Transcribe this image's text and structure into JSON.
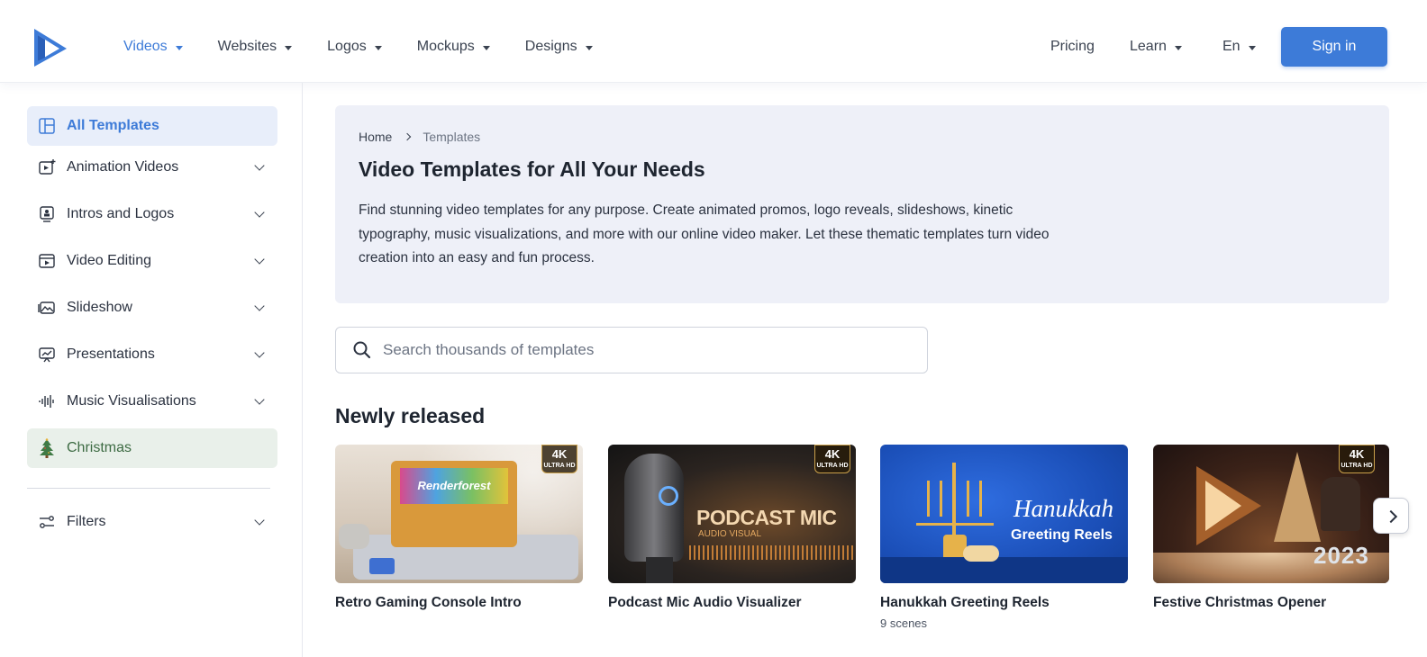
{
  "header": {
    "nav": [
      {
        "label": "Videos",
        "active": true
      },
      {
        "label": "Websites"
      },
      {
        "label": "Logos"
      },
      {
        "label": "Mockups"
      },
      {
        "label": "Designs"
      }
    ],
    "pricing": "Pricing",
    "learn": "Learn",
    "language": "En",
    "signin": "Sign in",
    "accent_color": "#3d7bd8"
  },
  "sidebar": {
    "items": [
      {
        "label": "All Templates",
        "icon": "grid-icon",
        "active": true
      },
      {
        "label": "Animation Videos",
        "icon": "video-plus-icon"
      },
      {
        "label": "Intros and Logos",
        "icon": "badge-icon"
      },
      {
        "label": "Video Editing",
        "icon": "film-icon"
      },
      {
        "label": "Slideshow",
        "icon": "image-icon"
      },
      {
        "label": "Presentations",
        "icon": "presentation-icon"
      },
      {
        "label": "Music Visualisations",
        "icon": "waveform-icon"
      },
      {
        "label": "Christmas",
        "icon": "christmas-tree-icon"
      }
    ],
    "filters": "Filters"
  },
  "hero": {
    "breadcrumb": [
      "Home",
      "Templates"
    ],
    "title": "Video Templates for All Your Needs",
    "description": "Find stunning video templates for any purpose. Create animated promos, logo reveals, slideshows, kinetic typography, music visualizations, and more with our online video maker. Let these thematic templates turn video creation into an easy and fun process."
  },
  "search": {
    "placeholder": "Search thousands of templates"
  },
  "section": {
    "title": "Newly released"
  },
  "cards": [
    {
      "title": "Retro Gaming Console Intro",
      "badge": "4K",
      "badge_sub": "ULTRA HD",
      "thumb_text": "Renderforest"
    },
    {
      "title": "Podcast Mic Audio Visualizer",
      "badge": "4K",
      "badge_sub": "ULTRA HD",
      "thumb_text": "PODCAST MIC",
      "thumb_sub": "AUDIO VISUAL"
    },
    {
      "title": "Hanukkah Greeting Reels",
      "subtitle": "9 scenes",
      "thumb_text": "Hanukkah",
      "thumb_sub": "Greeting Reels"
    },
    {
      "title": "Festive Christmas Opener",
      "badge": "4K",
      "badge_sub": "ULTRA HD",
      "thumb_text": "2023"
    }
  ]
}
